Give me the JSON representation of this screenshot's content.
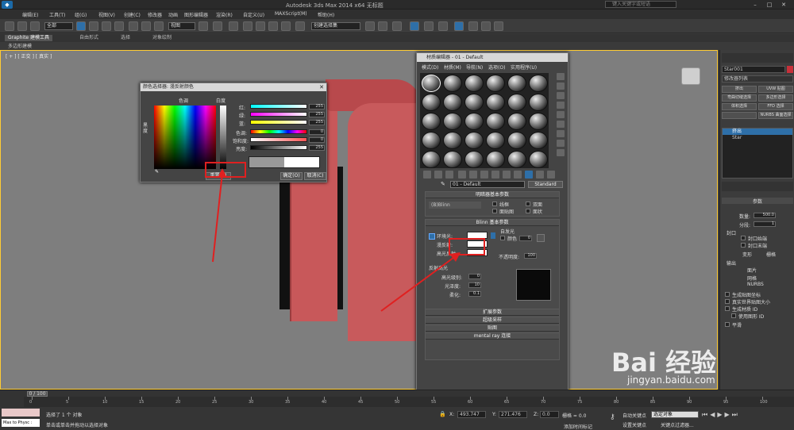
{
  "window": {
    "title": "Autodesk 3ds Max  2014 x64     无标题",
    "search_placeholder": "键入关键字或短语"
  },
  "menu": [
    "编辑(E)",
    "工具(T)",
    "组(G)",
    "视图(V)",
    "创建(C)",
    "修改器",
    "动画",
    "图形编辑器",
    "渲染(R)",
    "自定义(U)",
    "MAXScript(M)",
    "帮助(H)"
  ],
  "toolbar": {
    "selection_filter": "全部",
    "view_dropdown": "视图",
    "named_set": "创建选择集"
  },
  "ribbon": {
    "tabs": [
      "Graphite 建模工具",
      "自由形式",
      "选择",
      "对象绘制"
    ],
    "poly_label": "多边形建模"
  },
  "viewport": {
    "label": "[ + ] [ 正交 ] [ 真实 ]"
  },
  "color_dialog": {
    "title": "颜色选择器: 漫反射颜色",
    "hue_label": "色调",
    "whiteness_label": "白度",
    "blackness_label": "黑度",
    "rows": [
      {
        "label": "红:",
        "value": "255"
      },
      {
        "label": "绿:",
        "value": "255"
      },
      {
        "label": "蓝:",
        "value": "255"
      },
      {
        "label": "色调:",
        "value": "0"
      },
      {
        "label": "饱和度:",
        "value": "0"
      },
      {
        "label": "亮度:",
        "value": "255"
      }
    ],
    "reset": "重置(R)",
    "ok": "确定(O)",
    "cancel": "取消(C)"
  },
  "material_editor": {
    "title": "材质编辑器 - 01 - Default",
    "menu": [
      "模式(D)",
      "材质(M)",
      "导航(N)",
      "选项(O)",
      "实用程序(U)"
    ],
    "name": "01 - Default",
    "type": "Standard",
    "shader_rollout": "明暗器基本参数",
    "shader": "(B)Blinn",
    "shader_opts": [
      "线框",
      "双面",
      "面贴图",
      "面状"
    ],
    "blinn_rollout": "Blinn 基本参数",
    "self_illum": "自发光",
    "color_label": "颜色",
    "color_value": "0",
    "ambient": "环境光:",
    "diffuse": "漫反射:",
    "specular": "高光反射:",
    "opacity_label": "不透明度:",
    "opacity_value": "100",
    "highlights": "反射高光",
    "spec_level": "高光级别:",
    "spec_level_value": "0",
    "gloss": "光泽度:",
    "gloss_value": "10",
    "soften": "柔化:",
    "soften_value": "0.1",
    "extra_rollouts": [
      "扩展参数",
      "超级采样",
      "贴图",
      "mental ray 连接"
    ]
  },
  "command_panel": {
    "object_name": "Star001",
    "modifier_list": "修改器列表",
    "buttons": [
      "挤出",
      "UVW 贴图",
      "弯曲切缝选择",
      "多边形选择",
      "体积选择",
      "FFD 选择",
      "",
      "NURBS 曲面选择"
    ],
    "stack": [
      "挤出",
      "Star"
    ],
    "params_title": "参数",
    "amount_label": "数量:",
    "amount_value": "500.0",
    "segments_label": "分段:",
    "segments_value": "1",
    "capping": "封口",
    "cap_start": "封口始端",
    "cap_end": "封口末端",
    "morph": "变形",
    "grid": "栅格",
    "output": "输出",
    "out_patch": "面片",
    "out_mesh": "网格",
    "out_nurbs": "NURBS",
    "gen_coords": "生成贴图坐标",
    "real_world": "真实世界贴图大小",
    "gen_mat_ids": "生成材质 ID",
    "use_shape_ids": "使用图形 ID",
    "smooth": "平滑"
  },
  "timeline": {
    "frame": "0 / 100",
    "ticks": [
      "0",
      "5",
      "10",
      "15",
      "20",
      "25",
      "30",
      "35",
      "40",
      "45",
      "50",
      "55",
      "60",
      "65",
      "70",
      "75",
      "80",
      "85",
      "90",
      "95",
      "100"
    ]
  },
  "status": {
    "script_box": "Max to Physc :",
    "msg1": "选择了 1 个 对象",
    "msg2": "单击或单击并拖动以选择对象",
    "x": "493.747",
    "y": "271.476",
    "z": "0.0",
    "grid": "栅格 = 0.0",
    "auto_key": "自动关键点",
    "set_key": "设置关键点",
    "sel_obj": "选定对象",
    "key_filter": "关键点过滤器...",
    "add_time_tag": "添加时间标记"
  },
  "watermark": {
    "brand": "Bai 经验",
    "url": "jingyan.baidu.com"
  }
}
